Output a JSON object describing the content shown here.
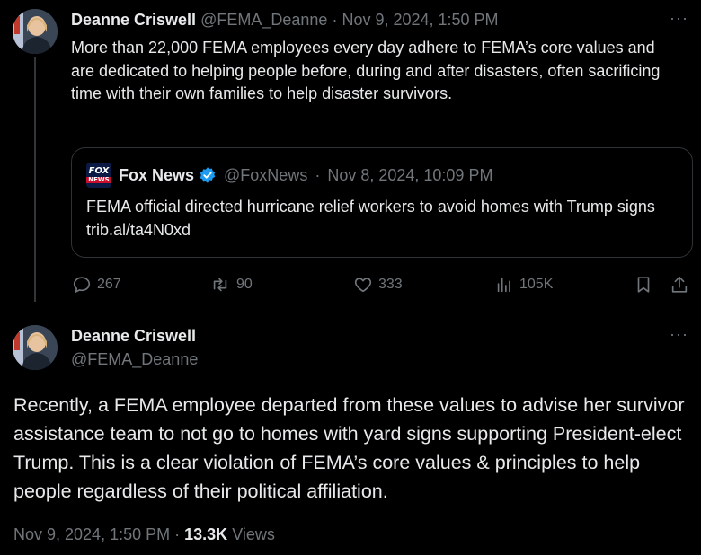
{
  "tweet1": {
    "author_name": "Deanne Criswell",
    "handle": "@FEMA_Deanne",
    "separator": "·",
    "timestamp": "Nov 9, 2024, 1:50 PM",
    "more_label": "···",
    "body": "More than 22,000 FEMA employees every day adhere to FEMA’s core values and are dedicated to helping people before, during and after disasters, often sacrificing time with their own families to help disaster survivors.",
    "quote": {
      "source_name": "Fox News",
      "handle": "@FoxNews",
      "separator": "·",
      "timestamp": "Nov 8, 2024, 10:09 PM",
      "body": "FEMA official directed hurricane relief workers to avoid homes with Trump signs trib.al/ta4N0xd"
    },
    "actions": {
      "replies": "267",
      "reposts": "90",
      "likes": "333",
      "views": "105K"
    }
  },
  "tweet2": {
    "author_name": "Deanne Criswell",
    "handle": "@FEMA_Deanne",
    "more_label": "···",
    "body": "Recently, a FEMA employee departed from these values to advise her survivor assistance team to not go to homes with yard signs supporting President-elect Trump. This is a clear violation of FEMA’s core values & principles to help people regardless of their political affiliation.",
    "timestamp": "Nov 9, 2024, 1:50 PM",
    "separator": "·",
    "view_count": "13.3K",
    "views_label": "Views"
  },
  "icons": {
    "verified_color": "#1d9bf0",
    "fox_logo_top": "FOX",
    "fox_logo_bottom": "NEWS"
  }
}
